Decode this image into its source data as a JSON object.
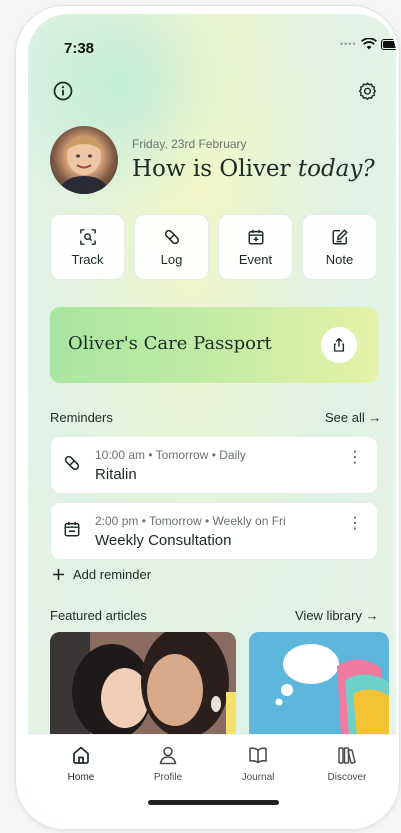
{
  "status": {
    "time": "7:38"
  },
  "header": {
    "date": "Friday, 23rd February",
    "title_prefix": "How is Oliver ",
    "title_emph": "today?"
  },
  "quick_actions": [
    {
      "label": "Track",
      "icon": "track-scan-icon"
    },
    {
      "label": "Log",
      "icon": "pill-icon"
    },
    {
      "label": "Event",
      "icon": "calendar-add-icon"
    },
    {
      "label": "Note",
      "icon": "note-edit-icon"
    }
  ],
  "passport": {
    "title": "Oliver's Care Passport"
  },
  "reminders": {
    "title": "Reminders",
    "see_all": "See all →",
    "items": [
      {
        "meta": "10:00 am • Tomorrow • Daily",
        "name": "Ritalin",
        "icon": "pill-icon"
      },
      {
        "meta": "2:00 pm • Tomorrow • Weekly on Fri",
        "name": "Weekly Consultation",
        "icon": "calendar-icon"
      }
    ],
    "add_label": "Add reminder"
  },
  "articles": {
    "title": "Featured articles",
    "view_library": "View library →"
  },
  "tabs": [
    {
      "label": "Home",
      "icon": "home-icon",
      "active": true
    },
    {
      "label": "Profile",
      "icon": "profile-icon",
      "active": false
    },
    {
      "label": "Journal",
      "icon": "book-icon",
      "active": false
    },
    {
      "label": "Discover",
      "icon": "library-icon",
      "active": false
    }
  ],
  "colors": {
    "accent_green": "#a8e6a0",
    "text": "#1c2a25",
    "muted": "#6a736f",
    "article_blue": "#5fb6dd"
  }
}
